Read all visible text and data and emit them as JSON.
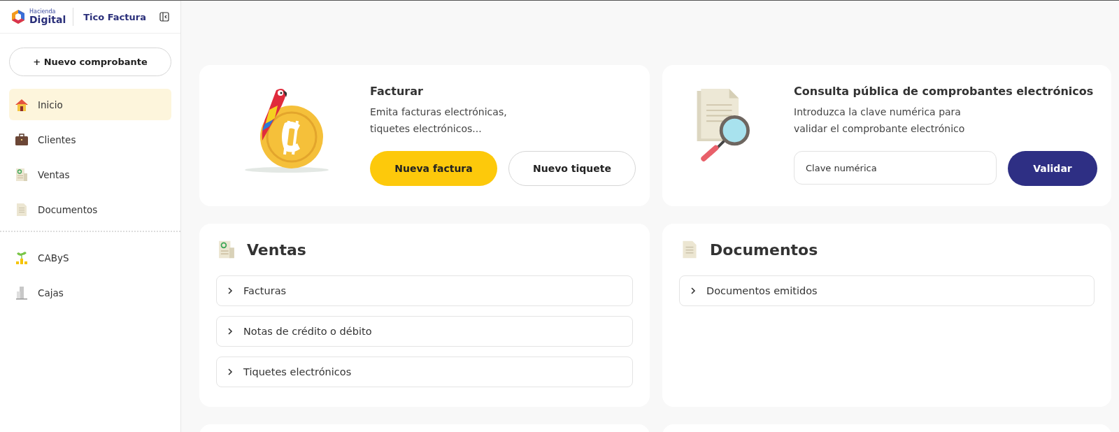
{
  "sidebar": {
    "logo_text": {
      "top": "Hacienda",
      "bottom": "Digital"
    },
    "app_name": "Tico Factura",
    "new_button": "+ Nuevo comprobante",
    "items": [
      {
        "label": "Inicio",
        "selected": true
      },
      {
        "label": "Clientes",
        "selected": false
      },
      {
        "label": "Ventas",
        "selected": false
      },
      {
        "label": "Documentos",
        "selected": false
      }
    ],
    "items_secondary": [
      {
        "label": "CAByS",
        "selected": false
      },
      {
        "label": "Cajas",
        "selected": false
      }
    ]
  },
  "facturar": {
    "title": "Facturar",
    "description": "Emita facturas electrónicas,\ntiquetes electrónicos...",
    "buttons": [
      "Nueva factura",
      "Nuevo tiquete"
    ]
  },
  "consulta": {
    "title": "Consulta pública de comprobantes electrónicos",
    "description": "Introduzca la clave numérica para\nvalidar el comprobante electrónico",
    "placeholder": "Clave numérica",
    "button": "Validar"
  },
  "ventas": {
    "title": "Ventas",
    "items": [
      {
        "label": "Facturas",
        "expanded": false
      },
      {
        "label": "Notas de crédito o débito",
        "expanded": false
      },
      {
        "label": "Tiquetes electrónicos",
        "expanded": false
      }
    ]
  },
  "documentos": {
    "title": "Documentos",
    "items": [
      {
        "label": "Documentos emitidos",
        "expanded": false
      }
    ]
  }
}
